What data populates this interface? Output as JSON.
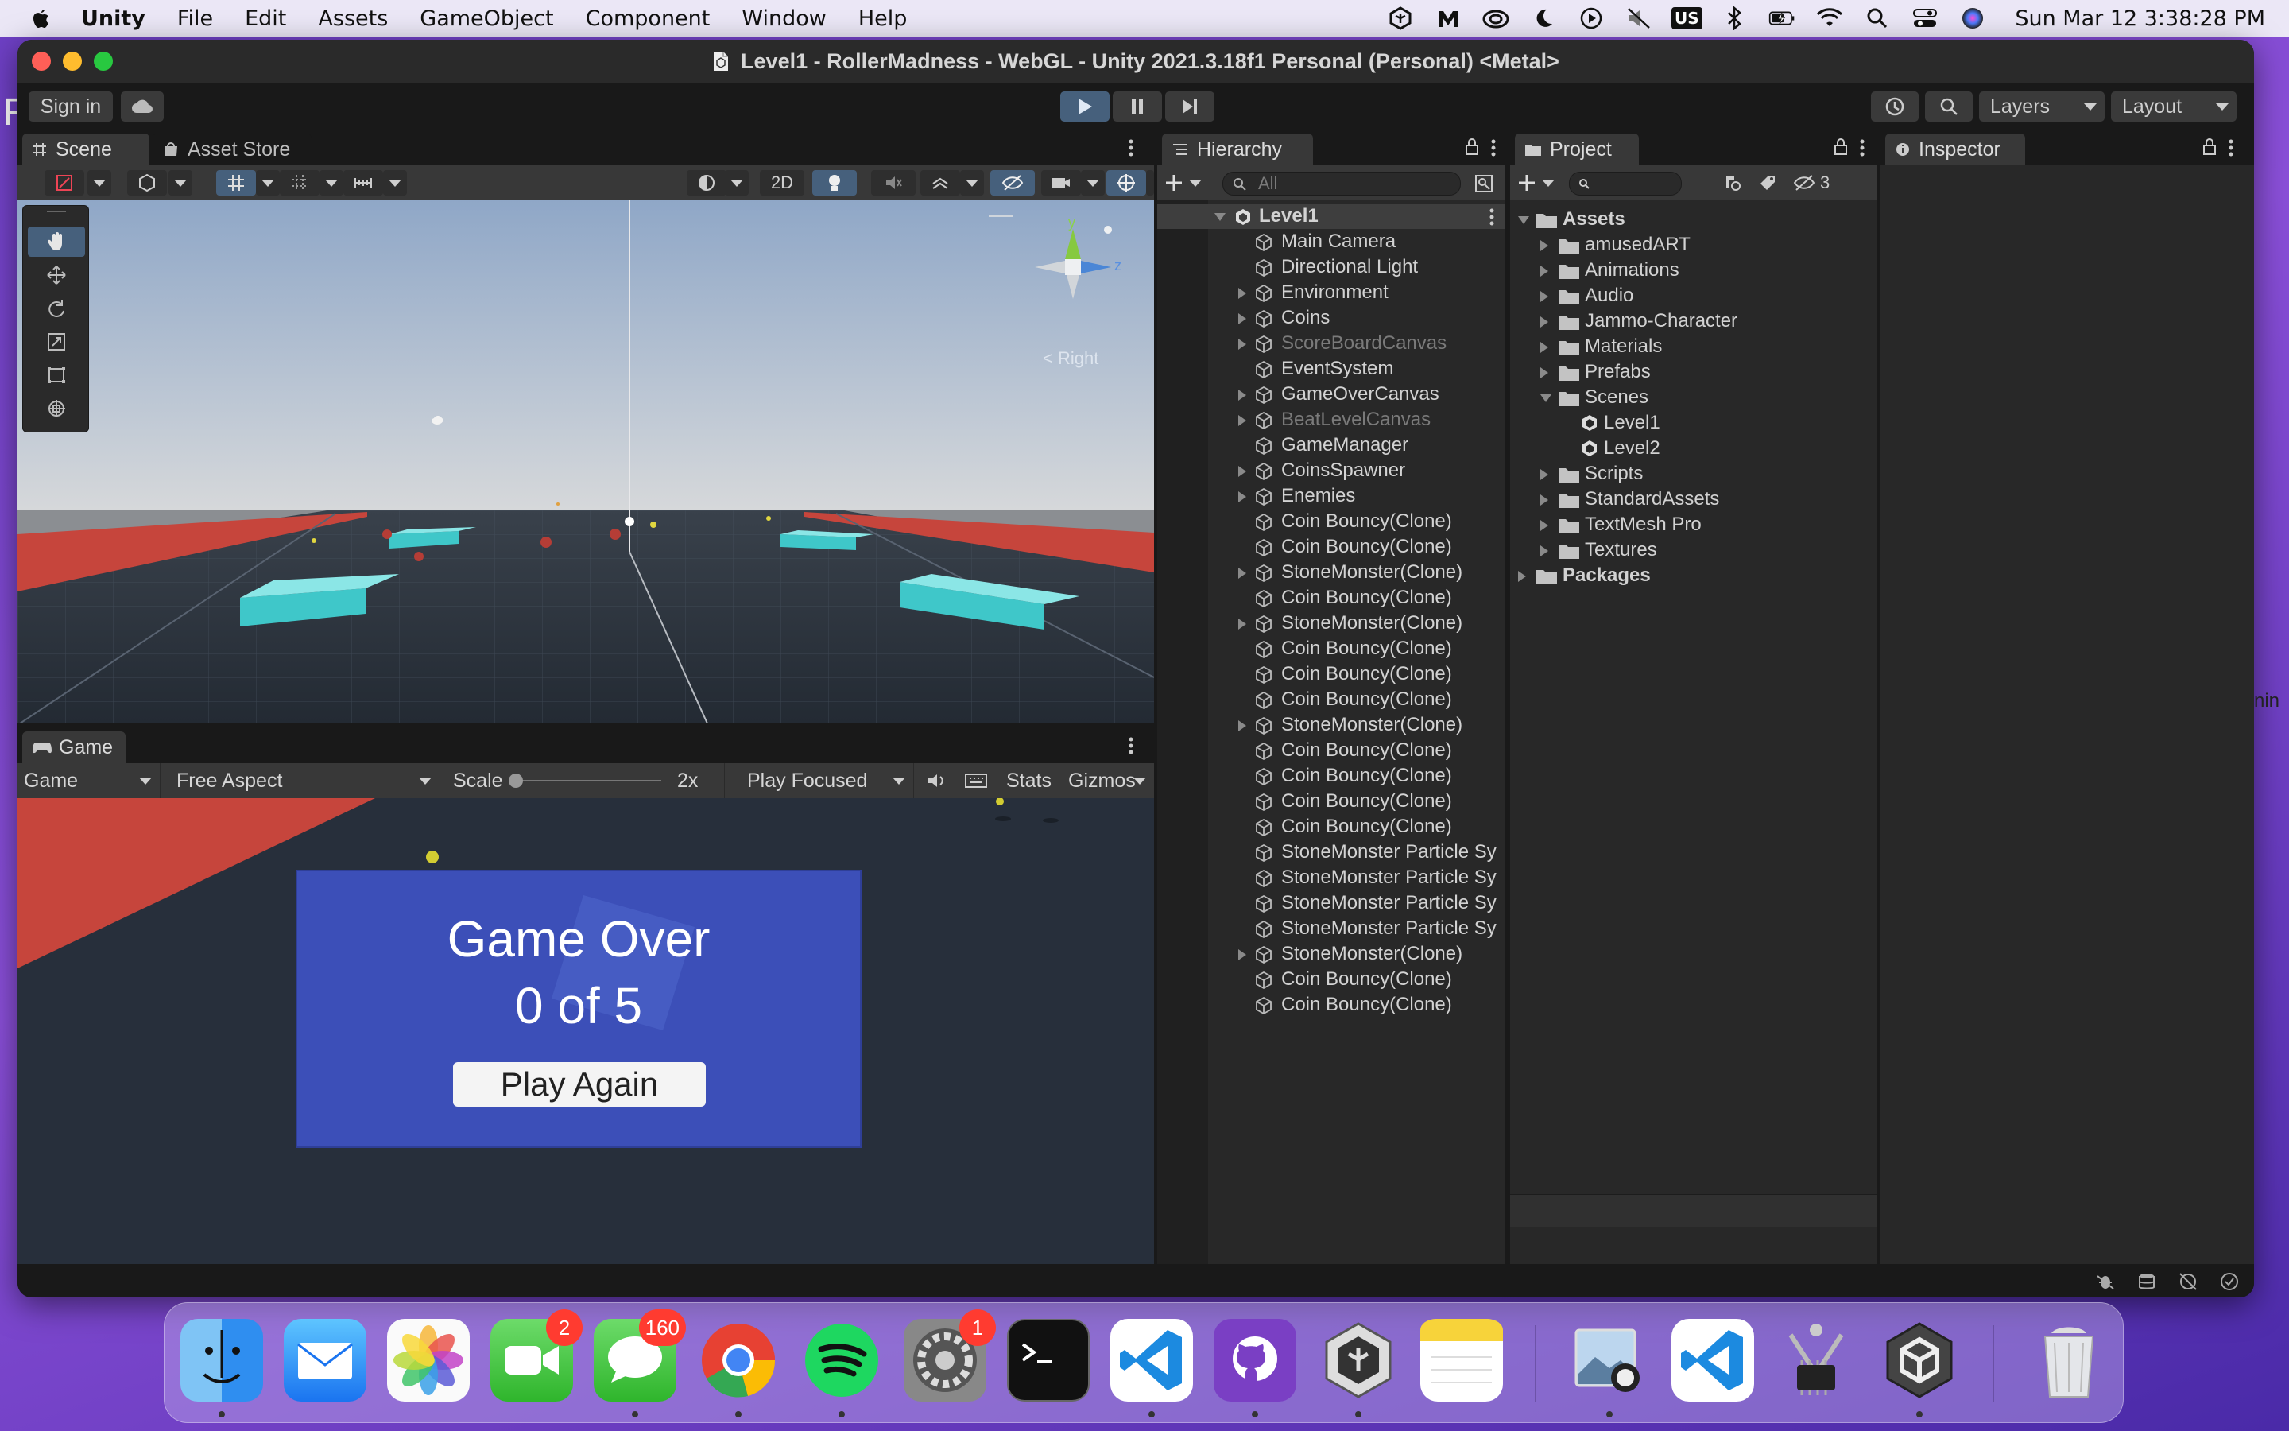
{
  "menubar": {
    "app": "Unity",
    "items": [
      "File",
      "Edit",
      "Assets",
      "GameObject",
      "Component",
      "Window",
      "Help"
    ],
    "clock": "Sun Mar 12  3:38:28 PM",
    "status_icons": [
      "unity-hub-icon",
      "meru-icon",
      "creative-cloud-icon",
      "moon-icon",
      "play-circle-icon",
      "mute-icon",
      "input-us-icon",
      "bluetooth-icon",
      "battery-icon",
      "wifi-icon",
      "spotlight-icon",
      "control-center-icon",
      "siri-icon"
    ],
    "input_source": "US"
  },
  "window": {
    "title": "Level1 - RollerMadness - WebGL - Unity 2021.3.18f1 Personal (Personal) <Metal>"
  },
  "toolbar": {
    "sign_in": "Sign in",
    "layers": "Layers",
    "layout": "Layout",
    "play_active": true
  },
  "scene": {
    "tabs": [
      "Scene",
      "Asset Store"
    ],
    "mode_2d": "2D",
    "gizmo_axes": {
      "y": "y",
      "z": "z"
    },
    "gizmo_view": "Right"
  },
  "game": {
    "tab": "Game",
    "display": "Game",
    "aspect": "Free Aspect",
    "scale_label": "Scale",
    "scale_value": "2x",
    "play_mode": "Play Focused",
    "stats": "Stats",
    "gizmos": "Gizmos",
    "overlay": {
      "title": "Game Over",
      "score": "0 of 5",
      "button": "Play Again"
    }
  },
  "hierarchy": {
    "tab": "Hierarchy",
    "search_placeholder": "All",
    "root": "Level1",
    "items": [
      {
        "label": "Main Camera",
        "arrow": false,
        "dim": false
      },
      {
        "label": "Directional Light",
        "arrow": false,
        "dim": false
      },
      {
        "label": "Environment",
        "arrow": true,
        "dim": false
      },
      {
        "label": "Coins",
        "arrow": true,
        "dim": false
      },
      {
        "label": "ScoreBoardCanvas",
        "arrow": true,
        "dim": true
      },
      {
        "label": "EventSystem",
        "arrow": false,
        "dim": false
      },
      {
        "label": "GameOverCanvas",
        "arrow": true,
        "dim": false
      },
      {
        "label": "BeatLevelCanvas",
        "arrow": true,
        "dim": true
      },
      {
        "label": "GameManager",
        "arrow": false,
        "dim": false
      },
      {
        "label": "CoinsSpawner",
        "arrow": true,
        "dim": false
      },
      {
        "label": "Enemies",
        "arrow": true,
        "dim": false
      },
      {
        "label": "Coin Bouncy(Clone)",
        "arrow": false,
        "dim": false
      },
      {
        "label": "Coin Bouncy(Clone)",
        "arrow": false,
        "dim": false
      },
      {
        "label": "StoneMonster(Clone)",
        "arrow": true,
        "dim": false
      },
      {
        "label": "Coin Bouncy(Clone)",
        "arrow": false,
        "dim": false
      },
      {
        "label": "StoneMonster(Clone)",
        "arrow": true,
        "dim": false
      },
      {
        "label": "Coin Bouncy(Clone)",
        "arrow": false,
        "dim": false
      },
      {
        "label": "Coin Bouncy(Clone)",
        "arrow": false,
        "dim": false
      },
      {
        "label": "Coin Bouncy(Clone)",
        "arrow": false,
        "dim": false
      },
      {
        "label": "StoneMonster(Clone)",
        "arrow": true,
        "dim": false
      },
      {
        "label": "Coin Bouncy(Clone)",
        "arrow": false,
        "dim": false
      },
      {
        "label": "Coin Bouncy(Clone)",
        "arrow": false,
        "dim": false
      },
      {
        "label": "Coin Bouncy(Clone)",
        "arrow": false,
        "dim": false
      },
      {
        "label": "Coin Bouncy(Clone)",
        "arrow": false,
        "dim": false
      },
      {
        "label": "StoneMonster Particle Sy",
        "arrow": false,
        "dim": false
      },
      {
        "label": "StoneMonster Particle Sy",
        "arrow": false,
        "dim": false
      },
      {
        "label": "StoneMonster Particle Sy",
        "arrow": false,
        "dim": false
      },
      {
        "label": "StoneMonster Particle Sy",
        "arrow": false,
        "dim": false
      },
      {
        "label": "StoneMonster(Clone)",
        "arrow": true,
        "dim": false
      },
      {
        "label": "Coin Bouncy(Clone)",
        "arrow": false,
        "dim": false
      },
      {
        "label": "Coin Bouncy(Clone)",
        "arrow": false,
        "dim": false
      }
    ]
  },
  "project": {
    "tab": "Project",
    "hidden_count": "3",
    "tree": [
      {
        "label": "Assets",
        "level": 0,
        "open": true,
        "bold": true,
        "type": "folder"
      },
      {
        "label": "amusedART",
        "level": 1,
        "open": false,
        "type": "folder"
      },
      {
        "label": "Animations",
        "level": 1,
        "open": false,
        "type": "folder"
      },
      {
        "label": "Audio",
        "level": 1,
        "open": false,
        "type": "folder"
      },
      {
        "label": "Jammo-Character",
        "level": 1,
        "open": false,
        "type": "folder"
      },
      {
        "label": "Materials",
        "level": 1,
        "open": false,
        "type": "folder"
      },
      {
        "label": "Prefabs",
        "level": 1,
        "open": false,
        "type": "folder"
      },
      {
        "label": "Scenes",
        "level": 1,
        "open": true,
        "type": "folder"
      },
      {
        "label": "Level1",
        "level": 2,
        "type": "scene"
      },
      {
        "label": "Level2",
        "level": 2,
        "type": "scene"
      },
      {
        "label": "Scripts",
        "level": 1,
        "open": false,
        "type": "folder"
      },
      {
        "label": "StandardAssets",
        "level": 1,
        "open": false,
        "type": "folder"
      },
      {
        "label": "TextMesh Pro",
        "level": 1,
        "open": false,
        "type": "folder"
      },
      {
        "label": "Textures",
        "level": 1,
        "open": false,
        "type": "folder"
      },
      {
        "label": "Packages",
        "level": 0,
        "open": false,
        "bold": true,
        "type": "folder"
      }
    ]
  },
  "inspector": {
    "tab": "Inspector"
  },
  "dock": {
    "apps": [
      {
        "name": "finder-icon",
        "badge": null,
        "running": true
      },
      {
        "name": "mail-icon",
        "badge": null,
        "running": false
      },
      {
        "name": "photos-icon",
        "badge": null,
        "running": false
      },
      {
        "name": "facetime-icon",
        "badge": "2",
        "running": false
      },
      {
        "name": "messages-icon",
        "badge": "160",
        "running": true
      },
      {
        "name": "chrome-icon",
        "badge": null,
        "running": true
      },
      {
        "name": "spotify-icon",
        "badge": null,
        "running": true
      },
      {
        "name": "system-preferences-icon",
        "badge": "1",
        "running": false
      },
      {
        "name": "terminal-icon",
        "badge": null,
        "running": false
      },
      {
        "name": "vscode-icon",
        "badge": null,
        "running": true
      },
      {
        "name": "github-desktop-icon",
        "badge": null,
        "running": true
      },
      {
        "name": "unity-hub-icon",
        "badge": null,
        "running": true
      },
      {
        "name": "notes-icon",
        "badge": null,
        "running": false
      },
      {
        "name": "preview-icon",
        "badge": null,
        "running": true
      },
      {
        "name": "vscode-icon",
        "badge": null,
        "running": false
      },
      {
        "name": "system-information-icon",
        "badge": null,
        "running": false
      },
      {
        "name": "unity-icon",
        "badge": null,
        "running": true
      },
      {
        "name": "trash-icon",
        "badge": null,
        "running": false
      }
    ]
  },
  "edge_text": {
    "left": "F",
    "right": "nin"
  }
}
